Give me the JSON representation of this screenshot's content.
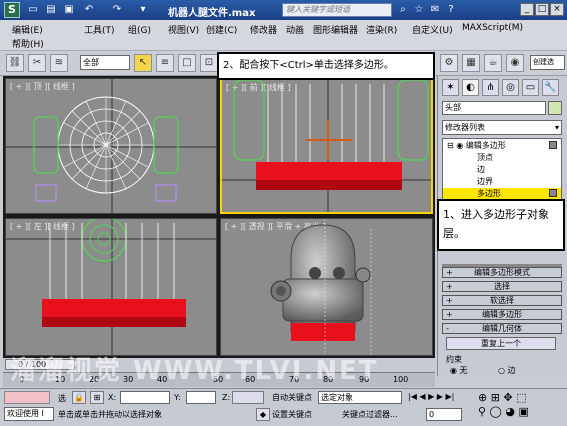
{
  "window": {
    "title": "机器人腿文件.max",
    "search_placeholder": "键入关键字或短语",
    "logo": "S"
  },
  "menu": [
    "编辑(E)",
    "工具(T)",
    "组(G)",
    "视图(V)",
    "创建(C)",
    "修改器",
    "动画",
    "图形编辑器",
    "渲染(R)",
    "自定义(U)",
    "MAXScript(M)",
    "帮助(H)"
  ],
  "toolbar": {
    "selection_filter": "全部",
    "right_label": "创建选"
  },
  "callouts": {
    "step2": "2、配合按下<Ctrl>单击选择多边形。",
    "step1": "1、进入多边形子对象层。"
  },
  "viewports": [
    {
      "label": "[ + ][ 顶 ][ 线框 ]"
    },
    {
      "label": "[ + ][ 前 ][ 线框 ]"
    },
    {
      "label": "[ + ][ 左 ][ 线框 ]"
    },
    {
      "label": "[ + ][ 透视 ][ 平滑 + 高光 ]"
    }
  ],
  "command_panel": {
    "object_name": "头部",
    "modifier_list": "修改器列表",
    "stack": [
      {
        "label": "编辑多边形",
        "level": 0
      },
      {
        "label": "顶点",
        "level": 1
      },
      {
        "label": "边",
        "level": 1
      },
      {
        "label": "边界",
        "level": 1
      },
      {
        "label": "多边形",
        "level": 1,
        "selected": true
      }
    ],
    "rollouts": [
      {
        "sign": "+",
        "label": "编辑多边形模式"
      },
      {
        "sign": "+",
        "label": "选择"
      },
      {
        "sign": "+",
        "label": "软选择"
      },
      {
        "sign": "+",
        "label": "编辑多边形"
      },
      {
        "sign": "-",
        "label": "编辑几何体"
      }
    ],
    "reset_button": "重复上一个",
    "constraint_label": "约束",
    "radio_none": "无",
    "radio_edge": "边"
  },
  "timeline": {
    "frame": "0 / 100",
    "ticks": [
      "0",
      "10",
      "20",
      "30",
      "40",
      "50",
      "60",
      "70",
      "80",
      "90",
      "100"
    ]
  },
  "status": {
    "welcome": "欢迎使用 I",
    "selected": "选",
    "x_label": "X:",
    "y_label": "Y:",
    "z_label": "Z:",
    "prompt": "单击或单击并拖动以选择对象",
    "auto_key": "自动关键点",
    "set_key": "设置关键点",
    "selection_set": "选定对象",
    "key_filters": "关键点过滤器...",
    "frame_field": "0"
  },
  "watermark": "溜溜视觉 WWW.TLVI.NET",
  "colors": {
    "accent_red": "#e8101c",
    "wire_white": "#ffffff",
    "wire_green": "#4fd94f",
    "wire_purple": "#b48cf0",
    "viewport_bg": "#8c8c8c"
  }
}
